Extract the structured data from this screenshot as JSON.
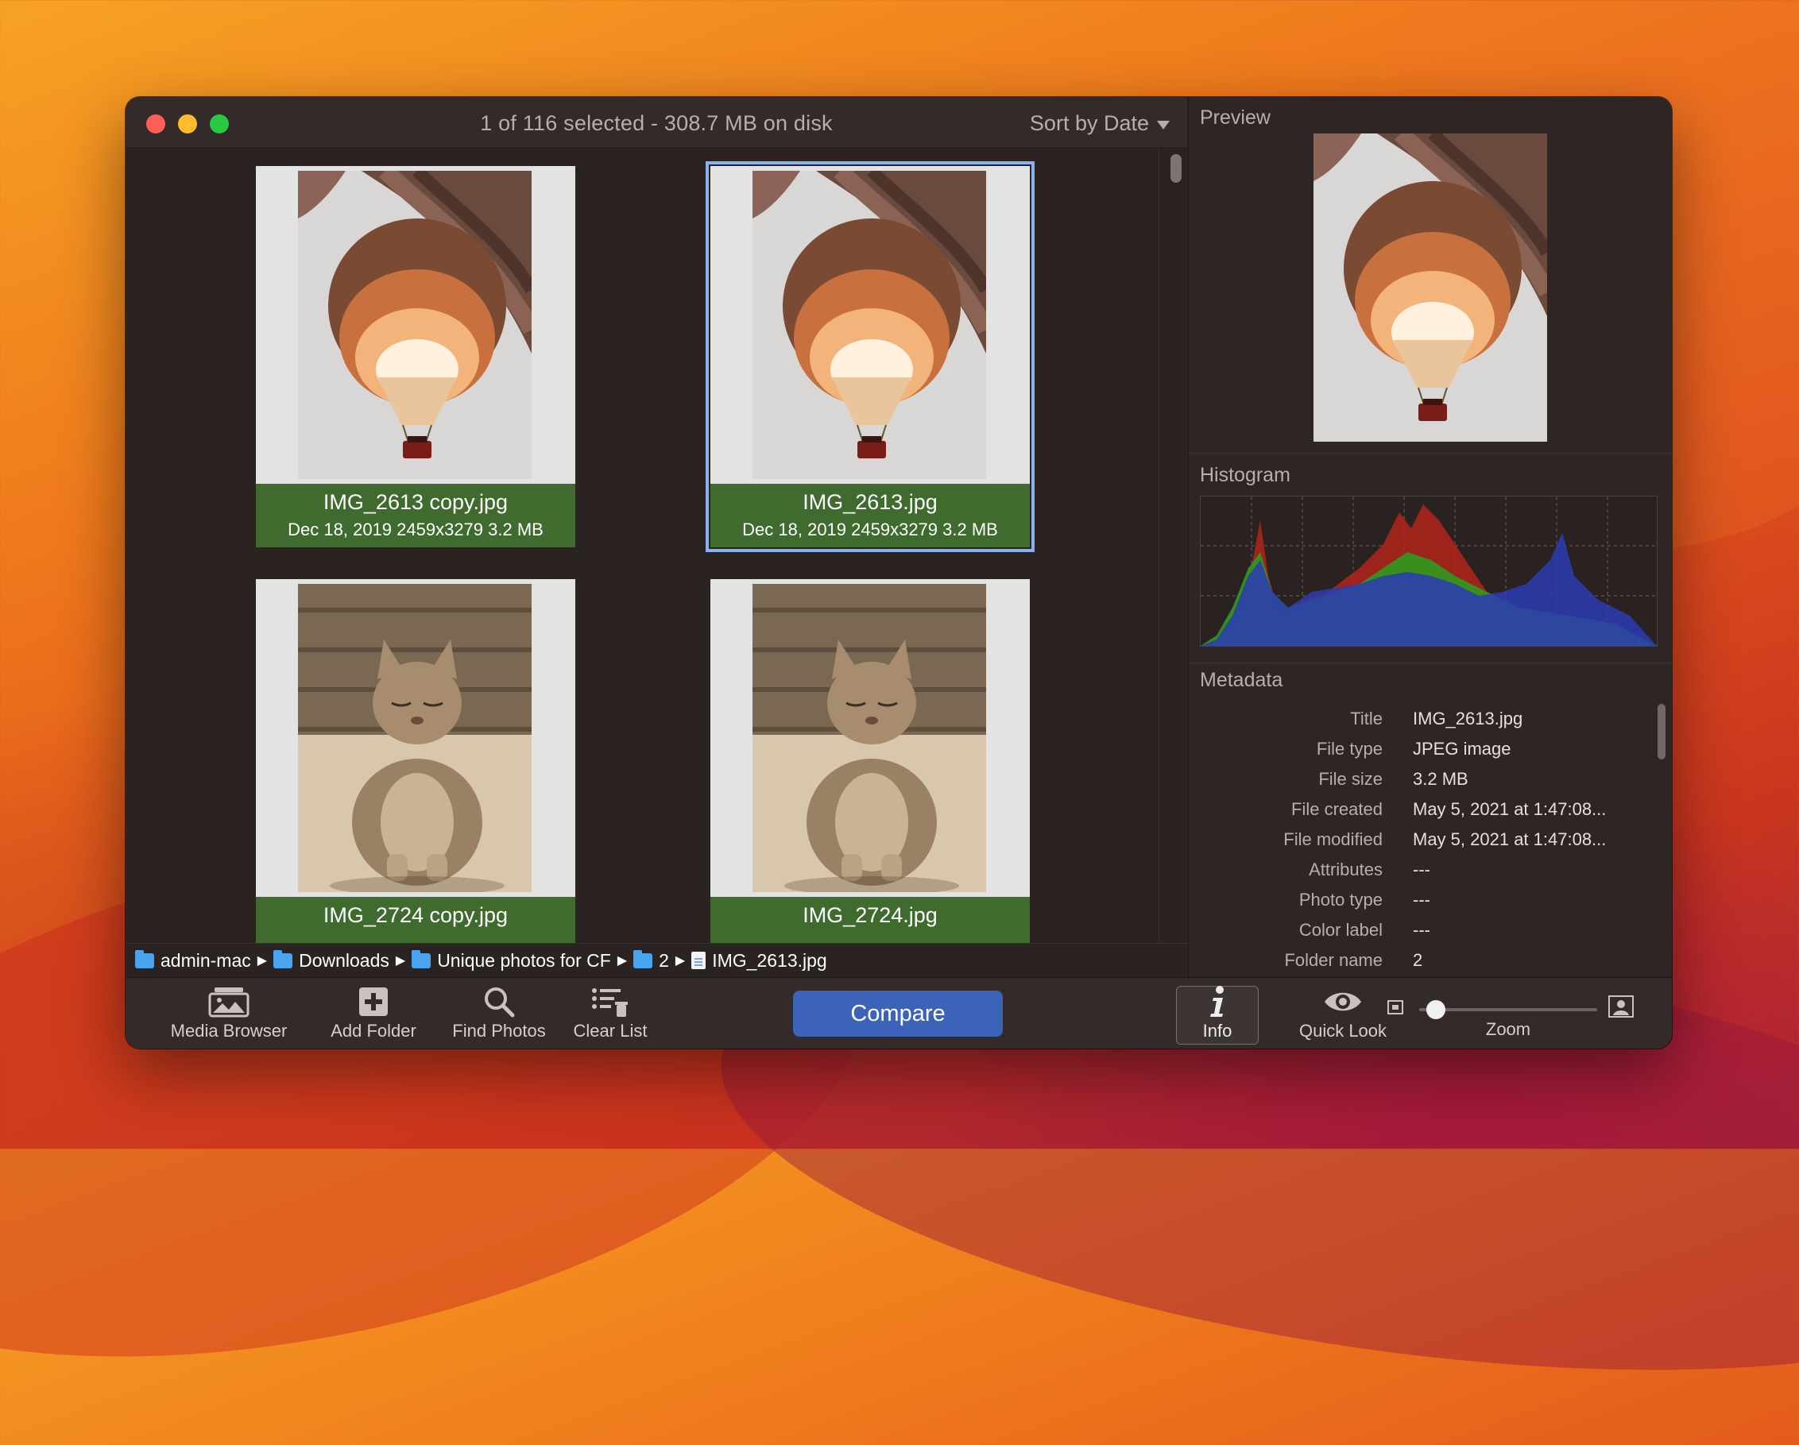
{
  "window": {
    "status": "1 of 116 selected - 308.7 MB on disk",
    "sort_label": "Sort by Date"
  },
  "items": [
    {
      "name": "IMG_2613 copy.jpg",
      "meta": "Dec 18, 2019  2459x3279  3.2 MB",
      "selected": false
    },
    {
      "name": "IMG_2613.jpg",
      "meta": "Dec 18, 2019  2459x3279  3.2 MB",
      "selected": true
    },
    {
      "name": "IMG_2724 copy.jpg",
      "meta": "",
      "selected": false
    },
    {
      "name": "IMG_2724.jpg",
      "meta": "",
      "selected": false
    }
  ],
  "path": [
    "admin-mac",
    "Downloads",
    "Unique photos for CF",
    "2",
    "IMG_2613.jpg"
  ],
  "toolbar": {
    "media_browser": "Media Browser",
    "add_folder": "Add Folder",
    "find_photos": "Find Photos",
    "clear_list": "Clear List",
    "compare": "Compare",
    "info": "Info",
    "quick_look": "Quick Look",
    "zoom": "Zoom",
    "zoom_level": 0.05
  },
  "side": {
    "preview_title": "Preview",
    "histogram_title": "Histogram",
    "metadata_title": "Metadata",
    "metadata": [
      {
        "key": "Title",
        "value": "IMG_2613.jpg"
      },
      {
        "key": "File type",
        "value": "JPEG image"
      },
      {
        "key": "File size",
        "value": "3.2 MB"
      },
      {
        "key": "File created",
        "value": "May 5, 2021 at 1:47:08..."
      },
      {
        "key": "File modified",
        "value": "May 5, 2021 at 1:47:08..."
      },
      {
        "key": "Attributes",
        "value": "---"
      },
      {
        "key": "Photo type",
        "value": "---"
      },
      {
        "key": "Color label",
        "value": "---"
      },
      {
        "key": "Folder name",
        "value": "2"
      }
    ]
  },
  "colors": {
    "caption_green": "#3f6b2e",
    "compare_blue": "#3b64b8",
    "selection_blue": "#8ab0f0"
  }
}
